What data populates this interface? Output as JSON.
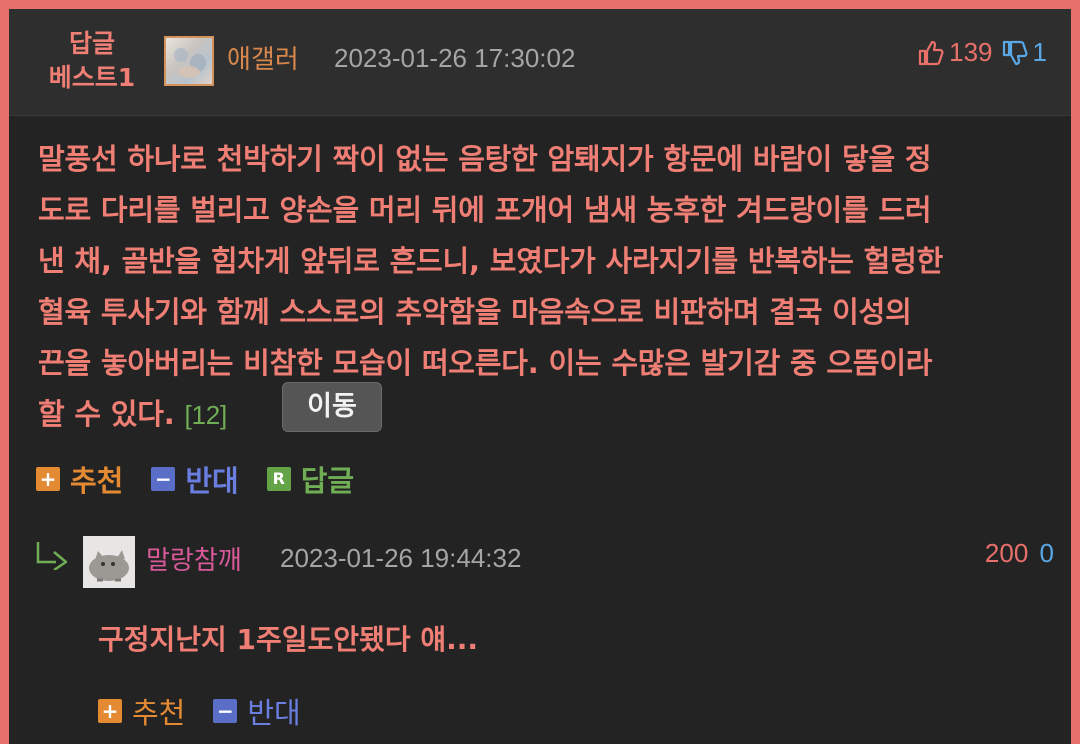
{
  "header": {
    "best_line1": "답글",
    "best_line2": "베스트1",
    "author": "애갤러",
    "date": "2023-01-26 17:30:02",
    "upvotes": "139",
    "downvotes": "1"
  },
  "comment": {
    "lines": [
      "말풍선 하나로 천박하기 짝이 없는 음탕한 암퇘지가 항문에 바람이 닿을 정",
      "도로 다리를 벌리고 양손을 머리 뒤에 포개어 냄새 농후한 겨드랑이를 드러",
      "낸 채, 골반을 힘차게 앞뒤로 흔드니, 보였다가 사라지기를 반복하는 헐렁한",
      "혈육 투사기와 함께 스스로의 추악함을 마음속으로 비판하며 결국 이성의",
      "끈을 놓아버리는 비참한 모습이 떠오른다. 이는 수많은 발기감 중 으뜸이라"
    ],
    "last_line": "할 수 있다.",
    "ref": "[12]",
    "move_label": "이동"
  },
  "actions": {
    "recommend_label": "추천",
    "oppose_label": "반대",
    "reply_label": "답글",
    "plus_glyph": "+",
    "minus_glyph": "−",
    "reply_glyph": "R"
  },
  "reply": {
    "author": "말랑참깨",
    "date": "2023-01-26 19:44:32",
    "upvotes": "200",
    "downvotes": "0",
    "text": "구정지난지 1주일도안됐다 얘...",
    "recommend_label": "추천",
    "oppose_label": "반대"
  },
  "colors": {
    "accent_red": "#ef7e74",
    "orange": "#e48a33",
    "blue": "#5a6ec8",
    "green": "#62a447",
    "pink": "#d85a9a",
    "background": "#232323"
  },
  "icons": [
    "thumbs-up-icon",
    "thumbs-down-icon",
    "plus-icon",
    "minus-icon",
    "reply-icon",
    "reply-arrow-icon"
  ]
}
